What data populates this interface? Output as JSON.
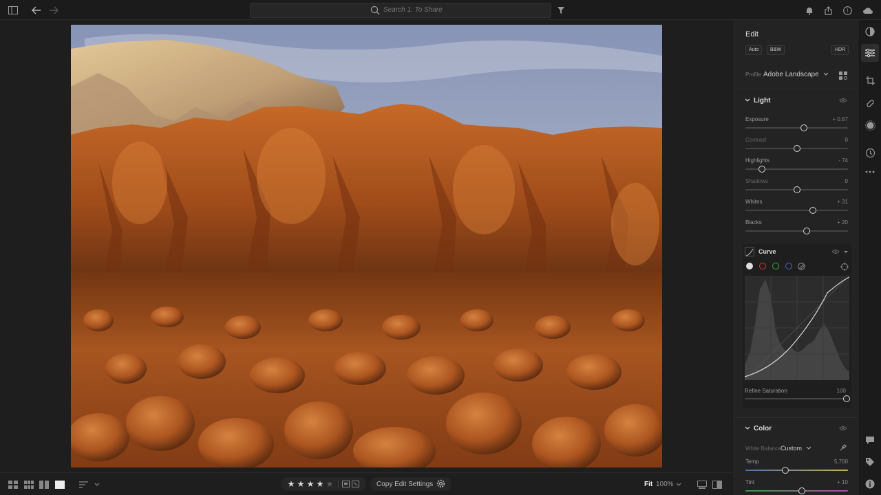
{
  "topbar": {
    "search_placeholder": "Search 1. To Share"
  },
  "bottombar": {
    "rating_stars": 4,
    "rating_max": 5,
    "copy_settings_label": "Copy Edit Settings",
    "fit_label": "Fit",
    "zoom_label": "100%"
  },
  "edit": {
    "title": "Edit",
    "auto_label": "Auto",
    "bw_label": "B&W",
    "hdr_label": "HDR",
    "profile_label": "Profile",
    "profile_value": "Adobe Landscape",
    "light": {
      "title": "Light",
      "sliders": [
        {
          "label": "Exposure",
          "value": "+ 0.57",
          "fraction": 0.57
        },
        {
          "label": "Contrast",
          "value": "0",
          "fraction": 0.5
        },
        {
          "label": "Highlights",
          "value": "- 74",
          "fraction": 0.16
        },
        {
          "label": "Shadows",
          "value": "0",
          "fraction": 0.5
        },
        {
          "label": "Whites",
          "value": "+ 31",
          "fraction": 0.66
        },
        {
          "label": "Blacks",
          "value": "+ 20",
          "fraction": 0.6
        }
      ]
    },
    "curve": {
      "title": "Curve",
      "refine_label": "Refine Saturation",
      "refine_value": "100",
      "refine_fraction": 1.0
    },
    "color": {
      "title": "Color",
      "wb_label": "White Balance",
      "wb_value": "Custom",
      "temp_label": "Temp",
      "temp_value": "5,700",
      "temp_fraction": 0.39,
      "tint_label": "Tint",
      "tint_value": "+ 10",
      "tint_fraction": 0.55
    }
  },
  "colors": {
    "panel_bg": "#232323",
    "accent_sky": "#a9b4cc",
    "rock": "#b8561e"
  }
}
